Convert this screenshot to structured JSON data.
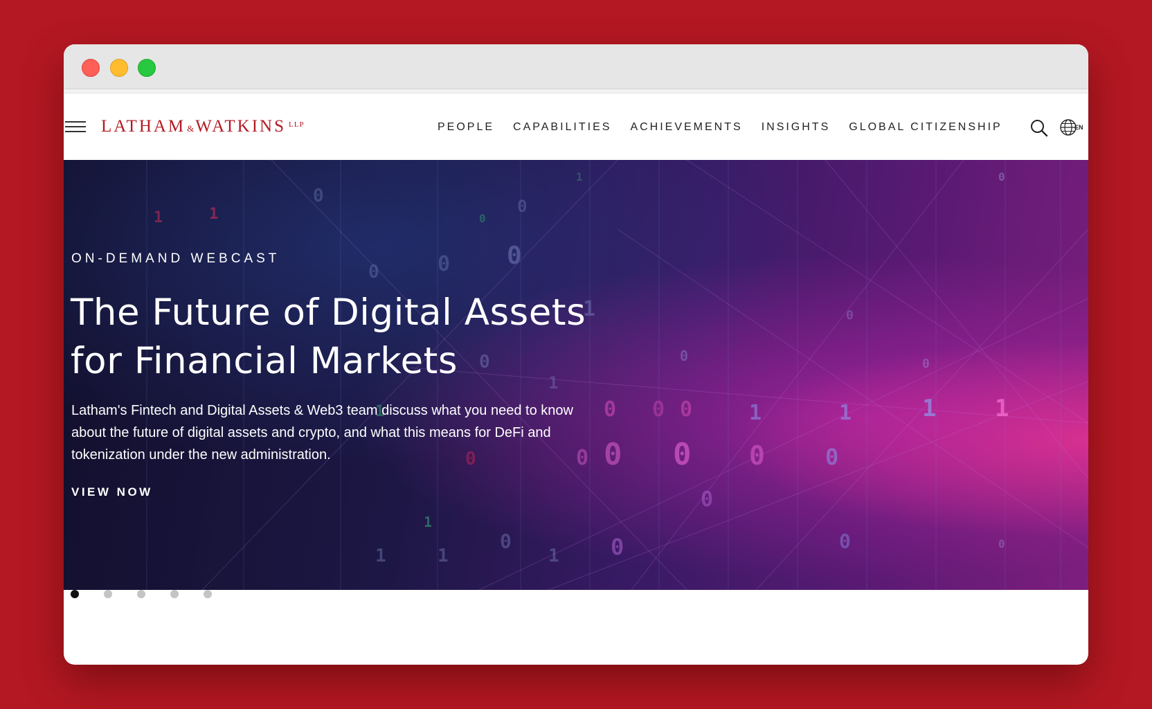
{
  "site": {
    "logo_left": "LATHAM",
    "logo_amp": "&",
    "logo_right": "WATKINS",
    "logo_suffix": "LLP"
  },
  "nav": {
    "items": [
      {
        "label": "PEOPLE"
      },
      {
        "label": "CAPABILITIES"
      },
      {
        "label": "ACHIEVEMENTS"
      },
      {
        "label": "INSIGHTS"
      },
      {
        "label": "GLOBAL CITIZENSHIP"
      }
    ],
    "language": "EN"
  },
  "hero": {
    "eyebrow": "ON-DEMAND WEBCAST",
    "headline": "The Future of Digital Assets for Financial Markets",
    "description": "Latham's Fintech and Digital Assets & Web3 team discuss what you need to know about the future of digital assets and crypto, and what this means for DeFi and tokenization under the new administration.",
    "cta": "VIEW NOW"
  },
  "carousel": {
    "slide_count": 5,
    "active_slide": 1
  },
  "icons": {
    "menu": "hamburger-icon",
    "search": "search-icon",
    "language": "globe-icon"
  },
  "colors": {
    "background": "#b41822",
    "brand_red": "#b41822",
    "nav_text": "#222222",
    "dot_active": "#111111",
    "dot_inactive": "#c4c4c4"
  }
}
